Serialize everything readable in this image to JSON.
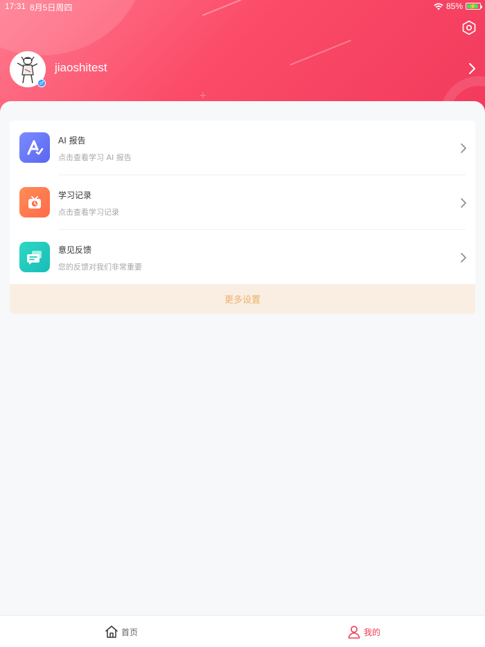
{
  "status_bar": {
    "time": "17:31",
    "date": "8月5日周四",
    "battery": "85%"
  },
  "profile": {
    "username": "jiaoshitest",
    "gender_symbol": "♂"
  },
  "menu": {
    "items": [
      {
        "title": "AI 报告",
        "subtitle": "点击查看学习 AI 报告",
        "icon": "ai-report-icon",
        "color": "#6f7cfb"
      },
      {
        "title": "学习记录",
        "subtitle": "点击查看学习记录",
        "icon": "study-record-icon",
        "color": "#ff7a52"
      },
      {
        "title": "意见反馈",
        "subtitle": "您的反馈对我们非常重要",
        "icon": "feedback-icon",
        "color": "#22cbbd"
      }
    ],
    "more_settings": "更多设置"
  },
  "tabbar": {
    "home_label": "首页",
    "mine_label": "我的",
    "active_color": "#ef3b55",
    "inactive_color": "#666666"
  },
  "colors": {
    "header_gradient_start": "#ff7a8e",
    "header_gradient_end": "#f23a5c"
  }
}
